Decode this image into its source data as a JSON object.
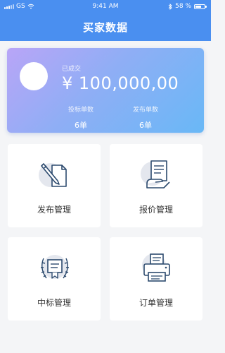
{
  "status_bar": {
    "carrier": "GS",
    "time": "9:41 AM",
    "battery": "58 %"
  },
  "header": {
    "title": "买家数据"
  },
  "summary": {
    "label": "已成交",
    "amount": "¥ 100,000,00",
    "stats": [
      {
        "label": "投标单数",
        "value": "6单"
      },
      {
        "label": "发布单数",
        "value": "6单"
      }
    ]
  },
  "tiles": [
    {
      "label": "发布管理",
      "icon": "edit-document-icon"
    },
    {
      "label": "报价管理",
      "icon": "quote-document-hand-icon"
    },
    {
      "label": "中标管理",
      "icon": "award-certificate-icon"
    },
    {
      "label": "订单管理",
      "icon": "printer-order-icon"
    }
  ],
  "colors": {
    "header": "#4a8ff0",
    "card_start": "#b9a5f7",
    "card_end": "#69b8f6",
    "icon_stroke": "#2c4a6e",
    "icon_bg": "#e4e7ee"
  }
}
